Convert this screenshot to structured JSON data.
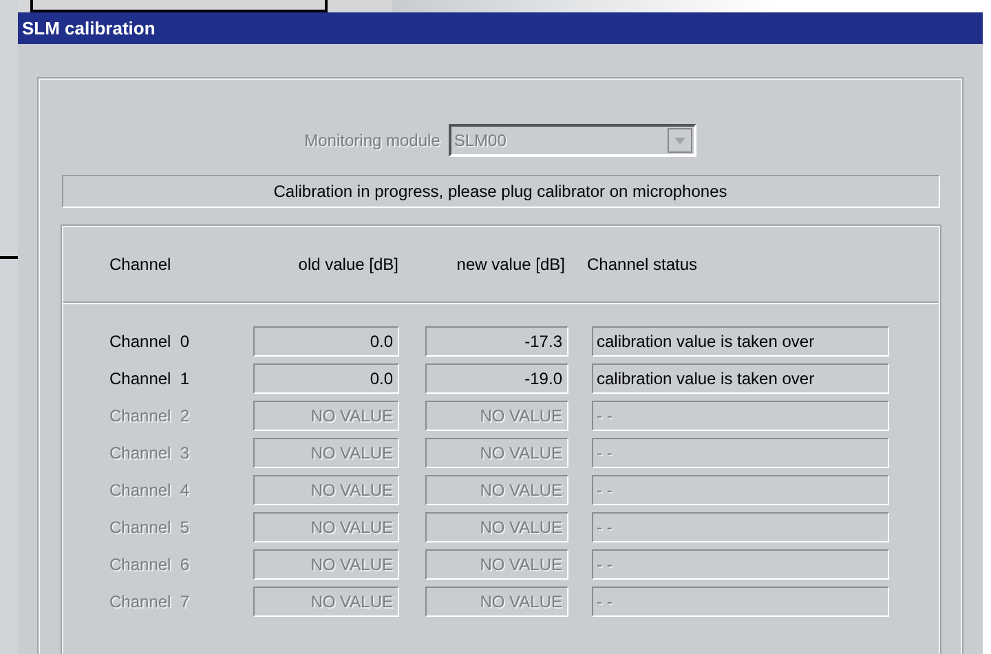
{
  "window": {
    "title": "SLM calibration"
  },
  "monitoring_module": {
    "label": "Monitoring module",
    "value": "SLM00",
    "disabled": true
  },
  "status_message": "Calibration in progress, please plug calibrator on microphones",
  "table": {
    "columns": [
      "Channel",
      "old value [dB]",
      "new value [dB]",
      "Channel status"
    ],
    "rows": [
      {
        "channel": "Channel",
        "index": "0",
        "old": "0.0",
        "new": "-17.3",
        "status": "calibration value is taken over",
        "disabled": false
      },
      {
        "channel": "Channel",
        "index": "1",
        "old": "0.0",
        "new": "-19.0",
        "status": "calibration value is taken over",
        "disabled": false
      },
      {
        "channel": "Channel",
        "index": "2",
        "old": "NO VALUE",
        "new": "NO VALUE",
        "status": "- -",
        "disabled": true
      },
      {
        "channel": "Channel",
        "index": "3",
        "old": "NO VALUE",
        "new": "NO VALUE",
        "status": "- -",
        "disabled": true
      },
      {
        "channel": "Channel",
        "index": "4",
        "old": "NO VALUE",
        "new": "NO VALUE",
        "status": "- -",
        "disabled": true
      },
      {
        "channel": "Channel",
        "index": "5",
        "old": "NO VALUE",
        "new": "NO VALUE",
        "status": "- -",
        "disabled": true
      },
      {
        "channel": "Channel",
        "index": "6",
        "old": "NO VALUE",
        "new": "NO VALUE",
        "status": "- -",
        "disabled": true
      },
      {
        "channel": "Channel",
        "index": "7",
        "old": "NO VALUE",
        "new": "NO VALUE",
        "status": "- -",
        "disabled": true
      }
    ]
  }
}
